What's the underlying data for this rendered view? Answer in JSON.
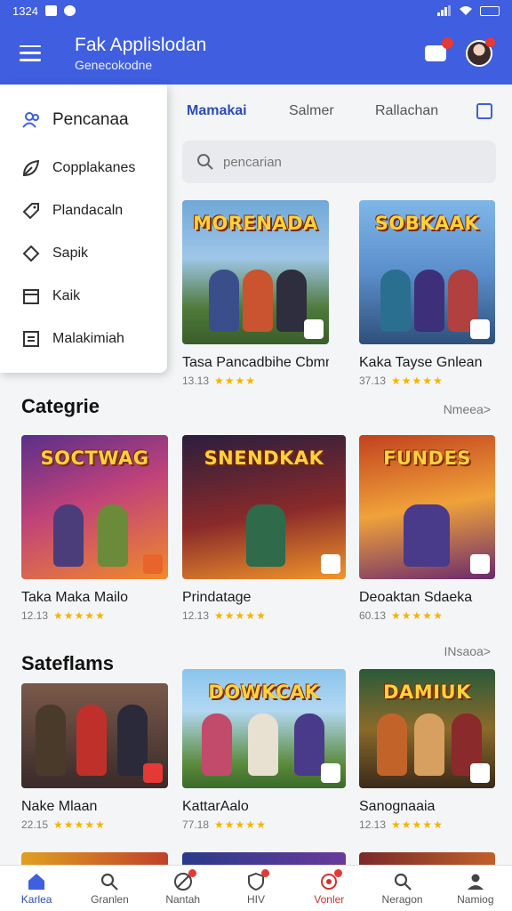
{
  "status": {
    "time": "1324"
  },
  "appbar": {
    "title": "Fak Applislodan",
    "subtitle": "Genecokodne"
  },
  "drawer": {
    "header": "Pencanaa",
    "items": [
      {
        "label": "Copplakanes",
        "icon": "leaf-icon"
      },
      {
        "label": "Plandacaln",
        "icon": "tag-icon"
      },
      {
        "label": "Sapik",
        "icon": "diamond-icon"
      },
      {
        "label": "Kaik",
        "icon": "calendar-icon"
      },
      {
        "label": "Malakimiah",
        "icon": "list-icon"
      }
    ]
  },
  "tabs": [
    {
      "label": "Mamakai",
      "active": true
    },
    {
      "label": "Salmer",
      "active": false
    },
    {
      "label": "Rallachan",
      "active": false
    }
  ],
  "search": {
    "placeholder": "pencarian"
  },
  "featured": [
    {
      "name": "Tasa Pancadbihe Cbmng,",
      "meta": "13.13",
      "art": "MORENADA",
      "rating": 4
    },
    {
      "name": "Kaka Tayse Gnlean",
      "meta": "37.13",
      "art": "SOBKAAK",
      "rating": 5
    }
  ],
  "sections": [
    {
      "title": "Categrie",
      "more": "Nmeea>",
      "items": [
        {
          "name": "Taka Maka Mailo",
          "meta": "12.13",
          "art": "SOCTWAG",
          "rating": 5
        },
        {
          "name": "Prindatage",
          "meta": "12.13",
          "art": "SNENDKAK",
          "rating": 5
        },
        {
          "name": "Deoaktan Sdaeka",
          "meta": "60.13",
          "art": "FUNDES",
          "rating": 5
        }
      ]
    },
    {
      "title": "Sateflams",
      "more": "INsaoa>",
      "items": [
        {
          "name": "Nake Mlaan",
          "meta": "22.15",
          "art": "",
          "rating": 5
        },
        {
          "name": "KattarAalo",
          "meta": "77.18",
          "art": "DOWKCAK",
          "rating": 5
        },
        {
          "name": "Sanognaaia",
          "meta": "12.13",
          "art": "DAMIUK",
          "rating": 5
        }
      ]
    }
  ],
  "bottom_nav": [
    {
      "label": "Karlea",
      "icon": "home-icon",
      "state": "active"
    },
    {
      "label": "Granlen",
      "icon": "search-icon",
      "state": ""
    },
    {
      "label": "Nantah",
      "icon": "compass-icon",
      "state": "dot"
    },
    {
      "label": "HIV",
      "icon": "shield-icon",
      "state": "dot"
    },
    {
      "label": "Vonler",
      "icon": "bell-icon",
      "state": "alert"
    },
    {
      "label": "Neragon",
      "icon": "search-icon",
      "state": ""
    },
    {
      "label": "Namiog",
      "icon": "profile-icon",
      "state": ""
    }
  ],
  "colors": {
    "primary": "#3f5ee0",
    "star": "#f5b400",
    "badge": "#e53935"
  }
}
